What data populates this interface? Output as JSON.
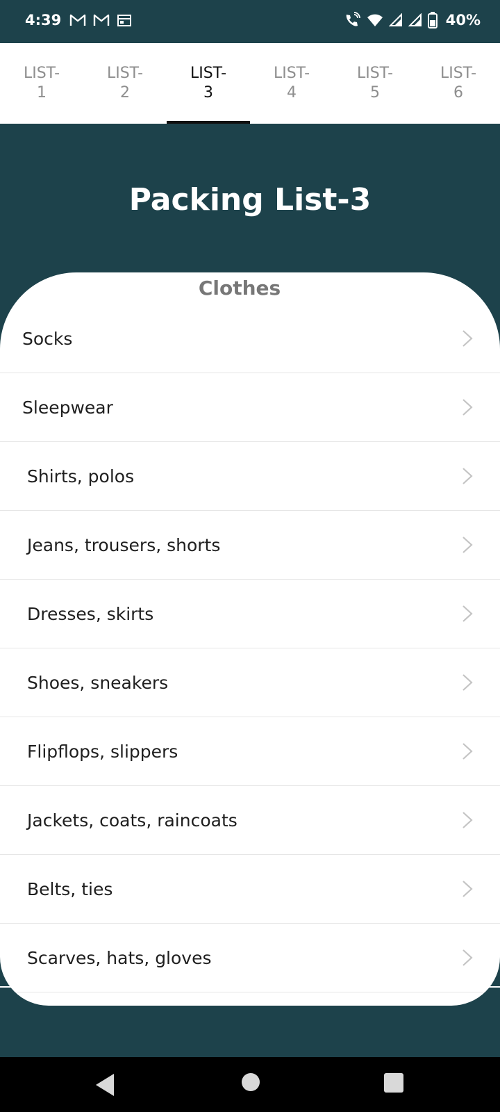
{
  "status_bar": {
    "time": "4:39",
    "battery": "40%",
    "icons": [
      "gmail-icon",
      "gmail-icon",
      "calendar-icon",
      "wifi-calling-icon",
      "wifi-icon",
      "signal-icon",
      "signal-icon",
      "battery-icon"
    ]
  },
  "tabs": [
    {
      "line1": "LIST-",
      "line2": "1",
      "active": false
    },
    {
      "line1": "LIST-",
      "line2": "2",
      "active": false
    },
    {
      "line1": "LIST-",
      "line2": "3",
      "active": true
    },
    {
      "line1": "LIST-",
      "line2": "4",
      "active": false
    },
    {
      "line1": "LIST-",
      "line2": "5",
      "active": false
    },
    {
      "line1": "LIST-",
      "line2": "6",
      "active": false
    }
  ],
  "header": {
    "title": "Packing List-3"
  },
  "section": {
    "title": "Clothes",
    "items": [
      "Socks",
      "Sleepwear",
      "Shirts, polos",
      "Jeans, trousers, shorts",
      "Dresses, skirts",
      "Shoes, sneakers",
      "Flipflops, slippers",
      "Jackets, coats, raincoats",
      "Belts, ties",
      "Scarves, hats, gloves"
    ]
  },
  "colors": {
    "background": "#1d424b",
    "card": "#ffffff",
    "active_tab": "#111111",
    "inactive_tab": "#8e8e8e"
  },
  "nav_bar": {
    "icons": [
      "back-icon",
      "home-icon",
      "recents-icon"
    ]
  }
}
